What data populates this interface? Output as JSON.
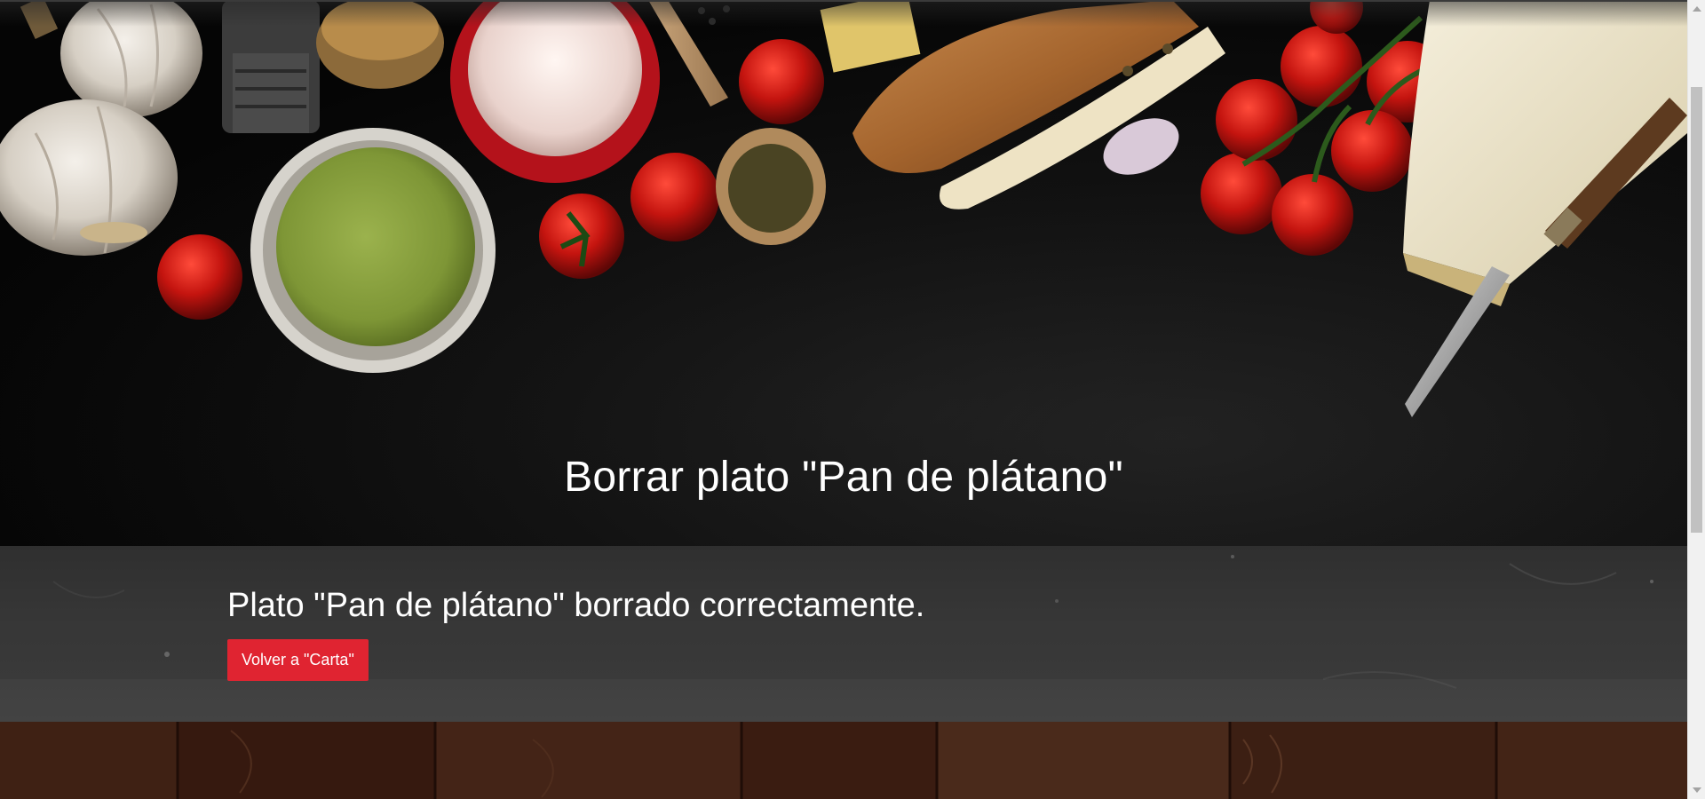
{
  "hero": {
    "title": "Borrar plato \"Pan de plátano\""
  },
  "confirmation": {
    "message": "Plato \"Pan de plátano\" borrado correctamente.",
    "back_button_label": "Volver a \"Carta\""
  },
  "colors": {
    "accent": "#e02431",
    "hero_background": "#080808",
    "confirm_background": "#333333",
    "wood": "#3a1d12"
  }
}
